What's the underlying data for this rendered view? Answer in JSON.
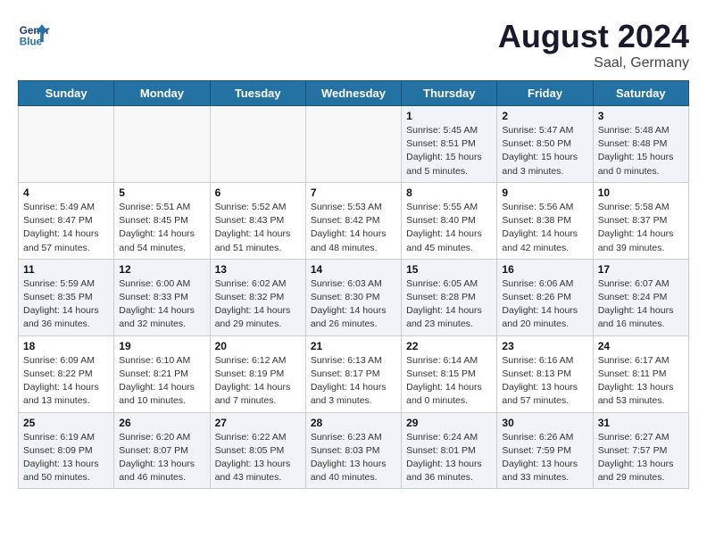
{
  "header": {
    "logo_line1": "General",
    "logo_line2": "Blue",
    "month_year": "August 2024",
    "location": "Saal, Germany"
  },
  "days_of_week": [
    "Sunday",
    "Monday",
    "Tuesday",
    "Wednesday",
    "Thursday",
    "Friday",
    "Saturday"
  ],
  "weeks": [
    [
      {
        "day": "",
        "info": ""
      },
      {
        "day": "",
        "info": ""
      },
      {
        "day": "",
        "info": ""
      },
      {
        "day": "",
        "info": ""
      },
      {
        "day": "1",
        "info": "Sunrise: 5:45 AM\nSunset: 8:51 PM\nDaylight: 15 hours\nand 5 minutes."
      },
      {
        "day": "2",
        "info": "Sunrise: 5:47 AM\nSunset: 8:50 PM\nDaylight: 15 hours\nand 3 minutes."
      },
      {
        "day": "3",
        "info": "Sunrise: 5:48 AM\nSunset: 8:48 PM\nDaylight: 15 hours\nand 0 minutes."
      }
    ],
    [
      {
        "day": "4",
        "info": "Sunrise: 5:49 AM\nSunset: 8:47 PM\nDaylight: 14 hours\nand 57 minutes."
      },
      {
        "day": "5",
        "info": "Sunrise: 5:51 AM\nSunset: 8:45 PM\nDaylight: 14 hours\nand 54 minutes."
      },
      {
        "day": "6",
        "info": "Sunrise: 5:52 AM\nSunset: 8:43 PM\nDaylight: 14 hours\nand 51 minutes."
      },
      {
        "day": "7",
        "info": "Sunrise: 5:53 AM\nSunset: 8:42 PM\nDaylight: 14 hours\nand 48 minutes."
      },
      {
        "day": "8",
        "info": "Sunrise: 5:55 AM\nSunset: 8:40 PM\nDaylight: 14 hours\nand 45 minutes."
      },
      {
        "day": "9",
        "info": "Sunrise: 5:56 AM\nSunset: 8:38 PM\nDaylight: 14 hours\nand 42 minutes."
      },
      {
        "day": "10",
        "info": "Sunrise: 5:58 AM\nSunset: 8:37 PM\nDaylight: 14 hours\nand 39 minutes."
      }
    ],
    [
      {
        "day": "11",
        "info": "Sunrise: 5:59 AM\nSunset: 8:35 PM\nDaylight: 14 hours\nand 36 minutes."
      },
      {
        "day": "12",
        "info": "Sunrise: 6:00 AM\nSunset: 8:33 PM\nDaylight: 14 hours\nand 32 minutes."
      },
      {
        "day": "13",
        "info": "Sunrise: 6:02 AM\nSunset: 8:32 PM\nDaylight: 14 hours\nand 29 minutes."
      },
      {
        "day": "14",
        "info": "Sunrise: 6:03 AM\nSunset: 8:30 PM\nDaylight: 14 hours\nand 26 minutes."
      },
      {
        "day": "15",
        "info": "Sunrise: 6:05 AM\nSunset: 8:28 PM\nDaylight: 14 hours\nand 23 minutes."
      },
      {
        "day": "16",
        "info": "Sunrise: 6:06 AM\nSunset: 8:26 PM\nDaylight: 14 hours\nand 20 minutes."
      },
      {
        "day": "17",
        "info": "Sunrise: 6:07 AM\nSunset: 8:24 PM\nDaylight: 14 hours\nand 16 minutes."
      }
    ],
    [
      {
        "day": "18",
        "info": "Sunrise: 6:09 AM\nSunset: 8:22 PM\nDaylight: 14 hours\nand 13 minutes."
      },
      {
        "day": "19",
        "info": "Sunrise: 6:10 AM\nSunset: 8:21 PM\nDaylight: 14 hours\nand 10 minutes."
      },
      {
        "day": "20",
        "info": "Sunrise: 6:12 AM\nSunset: 8:19 PM\nDaylight: 14 hours\nand 7 minutes."
      },
      {
        "day": "21",
        "info": "Sunrise: 6:13 AM\nSunset: 8:17 PM\nDaylight: 14 hours\nand 3 minutes."
      },
      {
        "day": "22",
        "info": "Sunrise: 6:14 AM\nSunset: 8:15 PM\nDaylight: 14 hours\nand 0 minutes."
      },
      {
        "day": "23",
        "info": "Sunrise: 6:16 AM\nSunset: 8:13 PM\nDaylight: 13 hours\nand 57 minutes."
      },
      {
        "day": "24",
        "info": "Sunrise: 6:17 AM\nSunset: 8:11 PM\nDaylight: 13 hours\nand 53 minutes."
      }
    ],
    [
      {
        "day": "25",
        "info": "Sunrise: 6:19 AM\nSunset: 8:09 PM\nDaylight: 13 hours\nand 50 minutes."
      },
      {
        "day": "26",
        "info": "Sunrise: 6:20 AM\nSunset: 8:07 PM\nDaylight: 13 hours\nand 46 minutes."
      },
      {
        "day": "27",
        "info": "Sunrise: 6:22 AM\nSunset: 8:05 PM\nDaylight: 13 hours\nand 43 minutes."
      },
      {
        "day": "28",
        "info": "Sunrise: 6:23 AM\nSunset: 8:03 PM\nDaylight: 13 hours\nand 40 minutes."
      },
      {
        "day": "29",
        "info": "Sunrise: 6:24 AM\nSunset: 8:01 PM\nDaylight: 13 hours\nand 36 minutes."
      },
      {
        "day": "30",
        "info": "Sunrise: 6:26 AM\nSunset: 7:59 PM\nDaylight: 13 hours\nand 33 minutes."
      },
      {
        "day": "31",
        "info": "Sunrise: 6:27 AM\nSunset: 7:57 PM\nDaylight: 13 hours\nand 29 minutes."
      }
    ]
  ]
}
